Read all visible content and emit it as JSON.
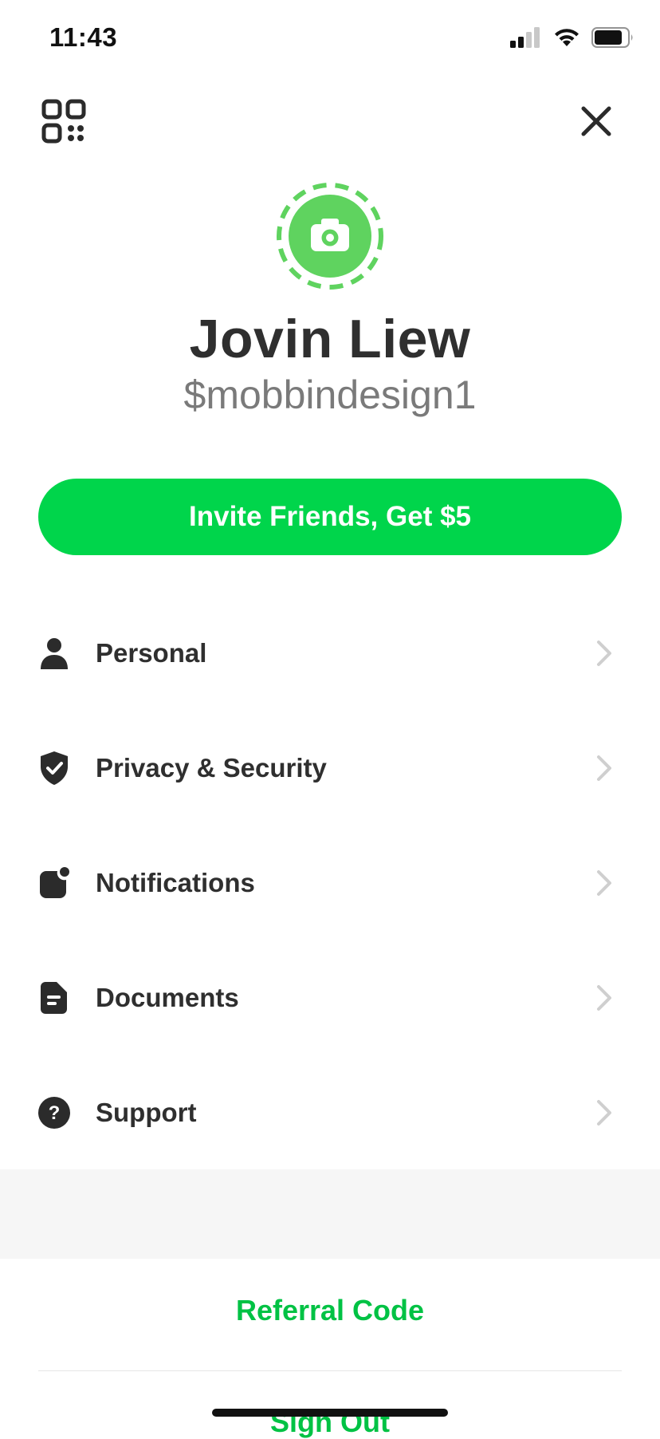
{
  "status_bar": {
    "time": "11:43",
    "icons": [
      "cellular-signal-icon",
      "wifi-icon",
      "battery-icon"
    ]
  },
  "top_bar": {
    "qr_icon": "qr-code-icon",
    "close_icon": "close-icon"
  },
  "profile": {
    "avatar_icon": "camera-icon",
    "name": "Jovin Liew",
    "handle": "$mobbindesign1"
  },
  "invite_button": {
    "label": "Invite Friends, Get $5"
  },
  "menu": {
    "items": [
      {
        "label": "Personal",
        "icon": "person-icon"
      },
      {
        "label": "Privacy & Security",
        "icon": "shield-check-icon"
      },
      {
        "label": "Notifications",
        "icon": "notification-badge-icon"
      },
      {
        "label": "Documents",
        "icon": "document-icon"
      },
      {
        "label": "Support",
        "icon": "help-icon"
      }
    ]
  },
  "footer": {
    "referral_label": "Referral Code",
    "signout_label": "Sign Out"
  },
  "colors": {
    "accent": "#00D54B",
    "accent_text": "#00C244",
    "text_primary": "#2F2F2F",
    "text_secondary": "#7A7A7A"
  }
}
